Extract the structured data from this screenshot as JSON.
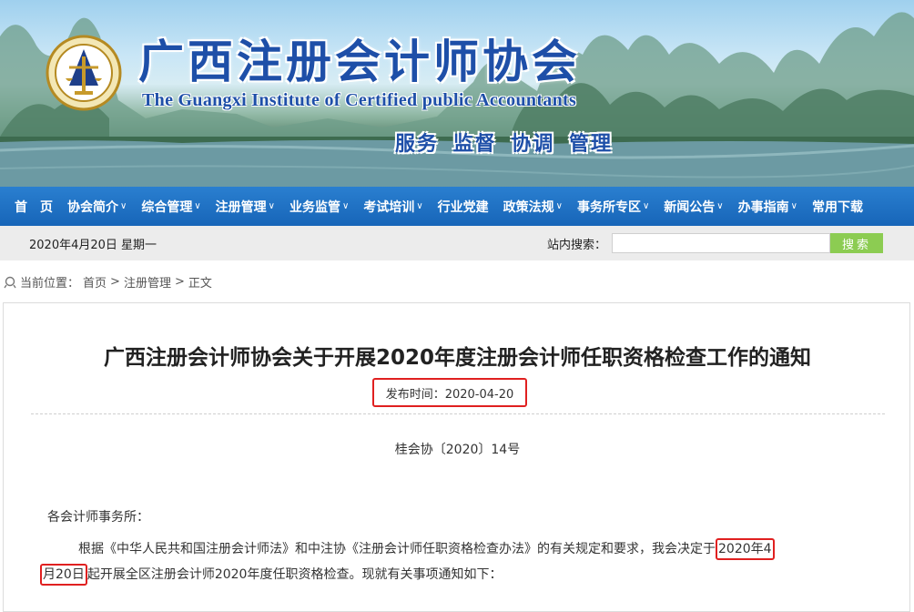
{
  "header": {
    "title_cn": "广西注册会计师协会",
    "title_en": "The Guangxi Institute of Certified public Accountants",
    "motto": "服务 监督 协调 管理"
  },
  "nav": {
    "items": [
      {
        "label": "首　页",
        "has_dropdown": false
      },
      {
        "label": "协会简介",
        "has_dropdown": true
      },
      {
        "label": "综合管理",
        "has_dropdown": true
      },
      {
        "label": "注册管理",
        "has_dropdown": true
      },
      {
        "label": "业务监管",
        "has_dropdown": true
      },
      {
        "label": "考试培训",
        "has_dropdown": true
      },
      {
        "label": "行业党建",
        "has_dropdown": false
      },
      {
        "label": "政策法规",
        "has_dropdown": true
      },
      {
        "label": "事务所专区",
        "has_dropdown": true
      },
      {
        "label": "新闻公告",
        "has_dropdown": true
      },
      {
        "label": "办事指南",
        "has_dropdown": true
      },
      {
        "label": "常用下载",
        "has_dropdown": false
      }
    ]
  },
  "infobar": {
    "date": "2020年4月20日 星期一",
    "search_label": "站内搜索：",
    "search_value": "",
    "search_button": "搜索"
  },
  "breadcrumb": {
    "prefix": "当前位置：",
    "items": [
      "首页",
      ">",
      "注册管理",
      ">",
      "正文"
    ]
  },
  "article": {
    "title": "广西注册会计师协会关于开展2020年度注册会计师任职资格检查工作的通知",
    "publish": "发布时间：2020-04-20",
    "doc_number": "桂会协〔2020〕14号",
    "salutation": "各会计师事务所：",
    "para_part1": "根据《中华人民共和国注册会计师法》和中注协《注册会计师任职资格检查办法》的有关规定和要求，我会决定于",
    "para_hl1": "2020年4",
    "para_hl2": "月20日",
    "para_part2": "起开展全区注册会计师2020年度任职资格检查。现就有关事项通知如下："
  },
  "colors": {
    "nav_bg": "#1a6cc0",
    "brand_blue": "#1e4fa8",
    "highlight_red": "#e02020",
    "search_button": "#8ccc52"
  }
}
